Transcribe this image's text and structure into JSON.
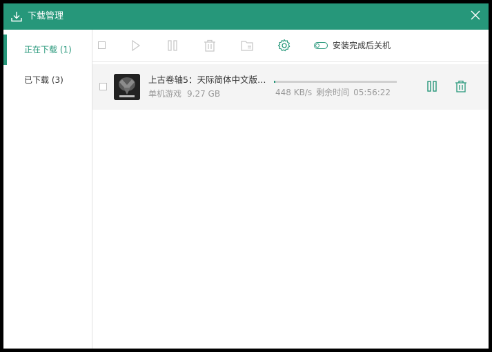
{
  "window": {
    "title": "下载管理"
  },
  "sidebar": {
    "items": [
      {
        "label": "正在下载 (1)",
        "active": true
      },
      {
        "label": "已下载 (3)",
        "active": false
      }
    ]
  },
  "toolbar": {
    "auto_shutdown_label": "安装完成后关机",
    "icons": [
      "select-all-checkbox",
      "play-icon",
      "pause-icon",
      "trash-icon",
      "folder-icon",
      "gear-icon"
    ]
  },
  "downloads": [
    {
      "name": "上古卷轴5：天际简体中文版(…",
      "category": "单机游戏",
      "size": "9.27 GB",
      "speed": "448 KB/s",
      "remaining_label": "剩余时间",
      "remaining_time": "05:56:22",
      "progress": 0.01
    }
  ],
  "colors": {
    "accent": "#26977a",
    "titlebar": "#26977a",
    "row_bg": "#f4f4f4"
  }
}
